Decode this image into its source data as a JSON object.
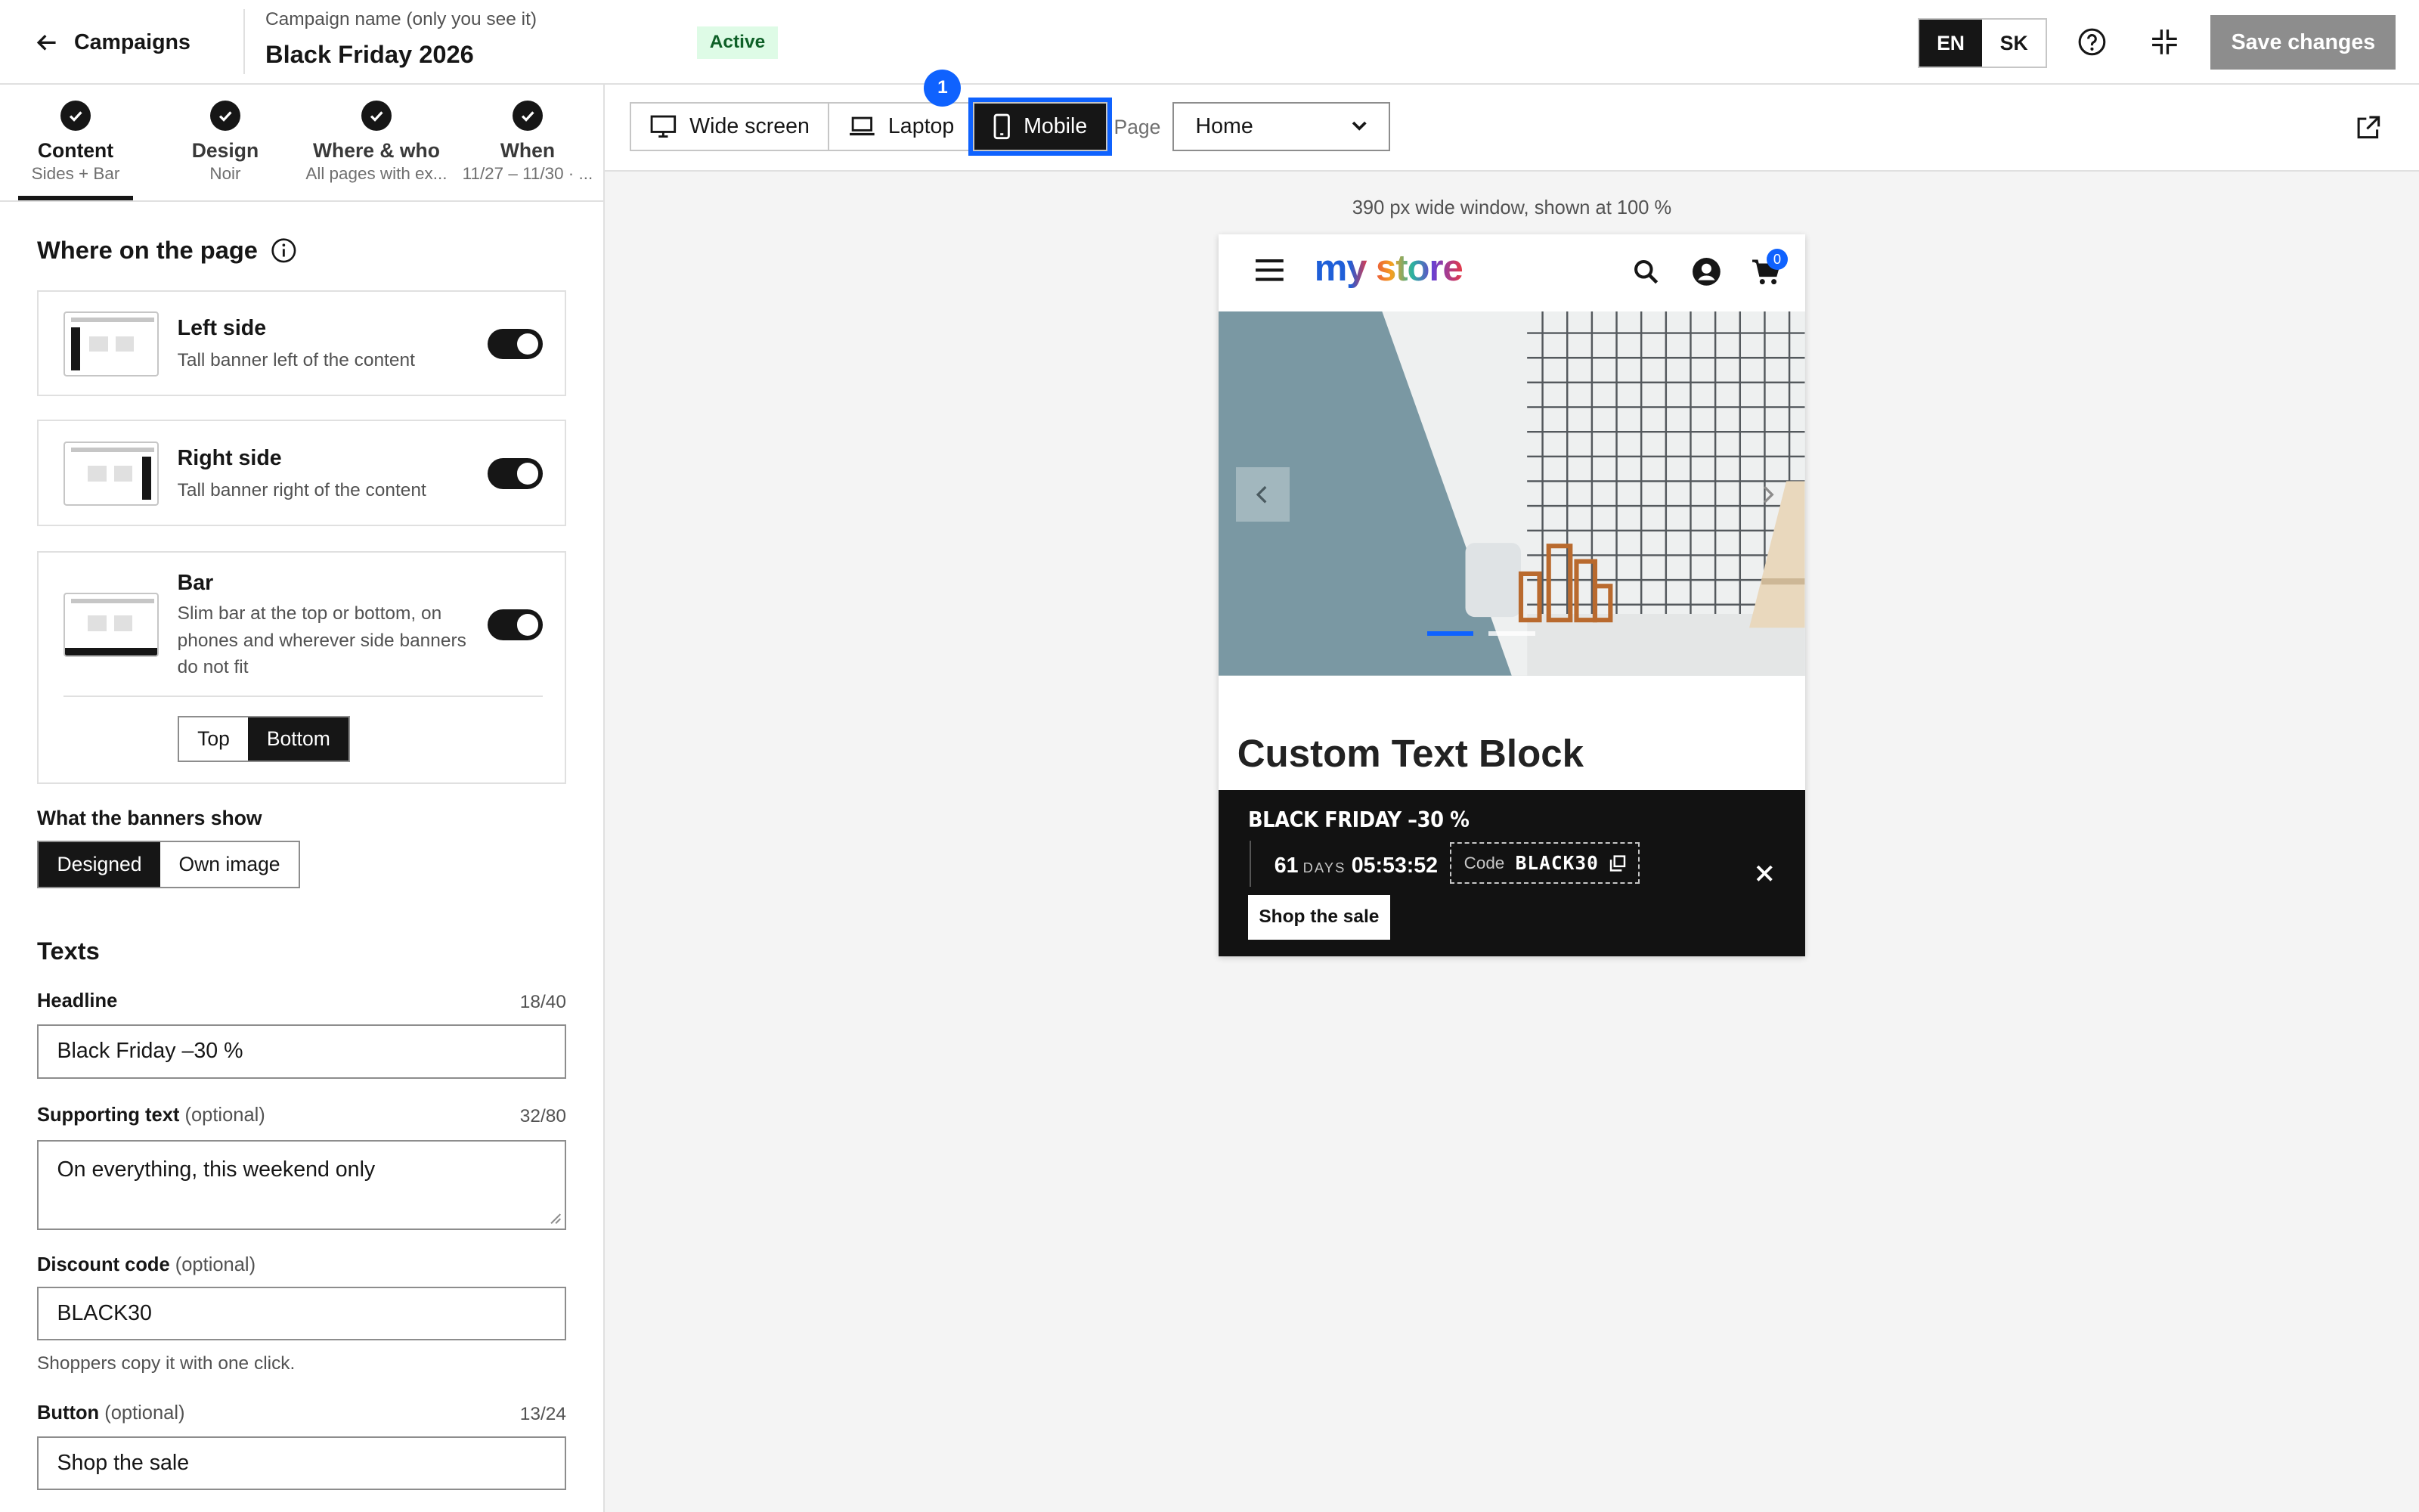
{
  "header": {
    "back_label": "Campaigns",
    "campaign_caption": "Campaign name (only you see it)",
    "campaign_name": "Black Friday 2026",
    "status": "Active",
    "languages": [
      "EN",
      "SK"
    ],
    "save_label": "Save changes"
  },
  "steps": [
    {
      "title": "Content",
      "subtitle": "Sides + Bar"
    },
    {
      "title": "Design",
      "subtitle": "Noir"
    },
    {
      "title": "Where & who",
      "subtitle": "All pages with ex..."
    },
    {
      "title": "When",
      "subtitle": "11/27 – 11/30 · ..."
    }
  ],
  "placement": {
    "title": "Where on the page",
    "cards": [
      {
        "title": "Left side",
        "desc": "Tall banner left of the content",
        "enabled": true
      },
      {
        "title": "Right side",
        "desc": "Tall banner right of the content",
        "enabled": true
      },
      {
        "title": "Bar",
        "desc": "Slim bar at the top or bottom, on phones and wherever side banners do not fit",
        "enabled": true
      }
    ],
    "bar_position": {
      "options": [
        "Top",
        "Bottom"
      ],
      "selected": "Bottom"
    }
  },
  "banner_show": {
    "label": "What the banners show",
    "options": [
      "Designed",
      "Own image"
    ],
    "selected": "Designed"
  },
  "texts": {
    "title": "Texts",
    "headline": {
      "label": "Headline",
      "count": "18/40",
      "value": "Black Friday –30 %"
    },
    "supporting": {
      "label": "Supporting text",
      "optional": "(optional)",
      "count": "32/80",
      "value": "On everything, this weekend only"
    },
    "discount": {
      "label": "Discount code",
      "optional": "(optional)",
      "value": "BLACK30",
      "helper": "Shoppers copy it with one click."
    },
    "button": {
      "label": "Button",
      "optional": "(optional)",
      "count": "13/24",
      "value": "Shop the sale"
    }
  },
  "preview": {
    "devices": [
      "Wide screen",
      "Laptop",
      "Mobile"
    ],
    "selected_device": "Mobile",
    "marker": "1",
    "page_label": "Page",
    "page_value": "Home",
    "caption": "390 px wide window, shown at 100 %",
    "store": {
      "logo": "my store",
      "cart_count": "0",
      "block_title": "Custom Text Block"
    },
    "promo": {
      "headline": "BLACK FRIDAY –30  %",
      "days": "61",
      "days_label": "DAYS",
      "timer": "05:53:52",
      "code_label": "Code",
      "code": "BLACK30",
      "button": "Shop the sale"
    }
  },
  "colors": {
    "accent": "#0f62fe",
    "dark": "#161616",
    "status_green": "#0e6027",
    "hero_blue_gray": "#7a98a3"
  }
}
